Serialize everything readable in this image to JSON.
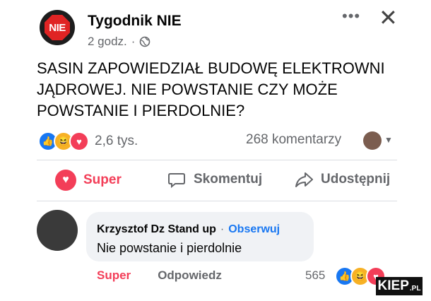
{
  "post": {
    "page_name": "Tygodnik NIE",
    "logo_text": "NIE",
    "time": "2 godz.",
    "separator": "·",
    "text": "SASIN ZAPOWIEDZIAŁ BUDOWĘ ELEKTROWNI JĄDROWEJ. NIE POWSTANIE CZY MOŻE POWSTANIE I PIERDOLNIE?",
    "reaction_count": "2,6 tys.",
    "comments_count": "268 komentarzy"
  },
  "actions": {
    "super": "Super",
    "comment": "Skomentuj",
    "share": "Udostępnij"
  },
  "comment": {
    "author": "Krzysztof Dz Stand up",
    "follow": "Obserwuj",
    "separator": "·",
    "text": "Nie powstanie i pierdolnie",
    "super": "Super",
    "reply": "Odpowiedz",
    "reaction_count": "565"
  },
  "watermark": {
    "main": "KIEP",
    "suffix": ".PL"
  },
  "icons": [
    "more-icon",
    "close-icon",
    "globe-icon",
    "like-icon",
    "haha-icon",
    "love-icon",
    "comment-icon",
    "share-icon"
  ],
  "colors": {
    "accent": "#1877f2",
    "love": "#f33e58",
    "haha": "#f7b125",
    "muted": "#65676b"
  }
}
